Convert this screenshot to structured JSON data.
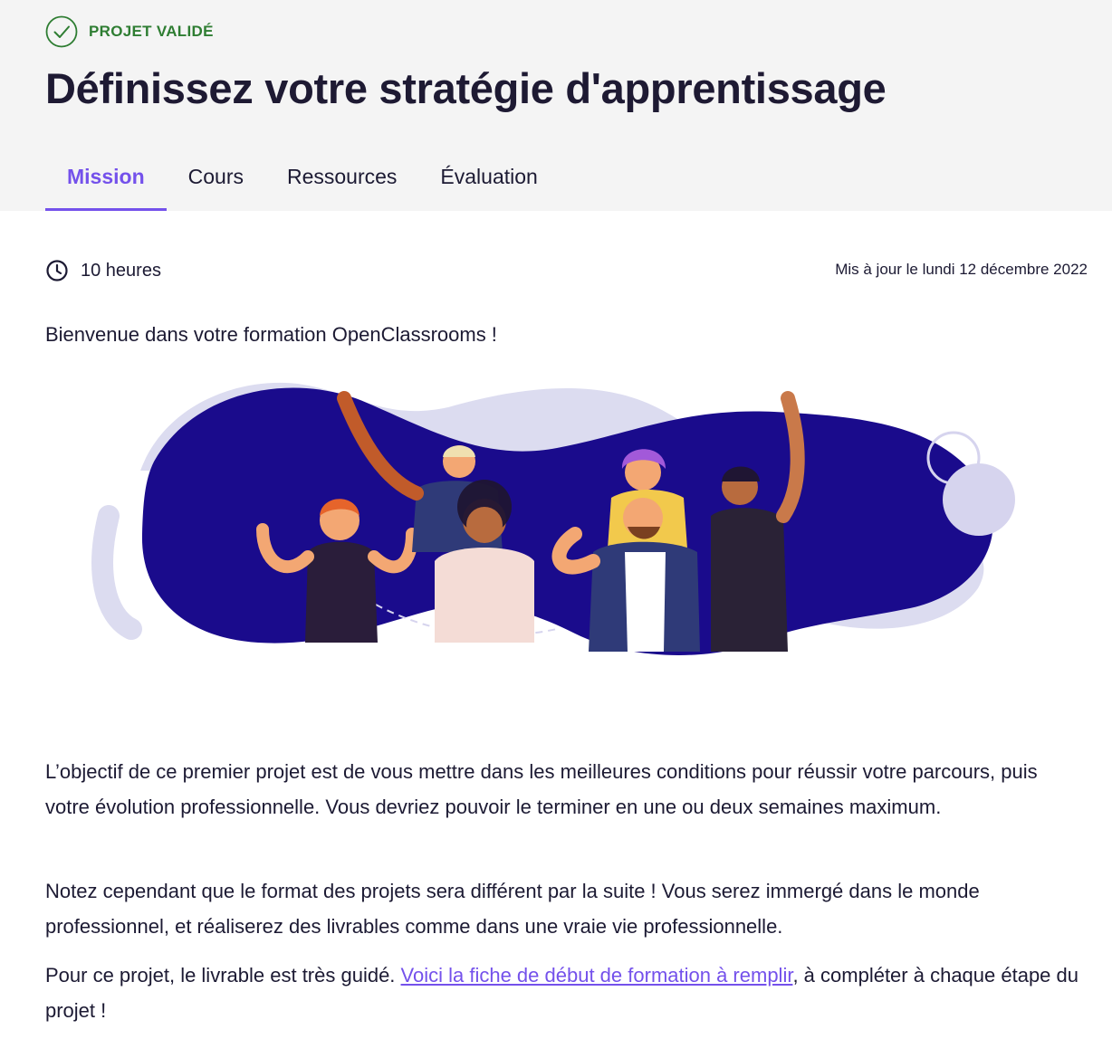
{
  "header": {
    "status_badge": "PROJET VALIDÉ",
    "title": "Définissez votre stratégie d'apprentissage"
  },
  "tabs": [
    {
      "label": "Mission",
      "active": true
    },
    {
      "label": "Cours",
      "active": false
    },
    {
      "label": "Ressources",
      "active": false
    },
    {
      "label": "Évaluation",
      "active": false
    }
  ],
  "meta": {
    "duration": "10 heures",
    "updated": "Mis à jour le lundi 12 décembre 2022"
  },
  "content": {
    "welcome": "Bienvenue dans votre formation OpenClassrooms !",
    "paragraph1": "L’objectif de ce premier projet est de vous mettre dans les meilleures conditions pour réussir votre parcours, puis votre évolution professionnelle. Vous devriez pouvoir le terminer en une ou deux semaines maximum.",
    "paragraph2": "Notez cependant que le format des projets sera différent par la suite ! Vous serez immergé dans le monde professionnel, et réaliserez des livrables comme dans une vraie vie professionnelle.",
    "paragraph3_before": "Pour ce projet, le livrable est très guidé. ",
    "paragraph3_link": "Voici la fiche de début de formation à remplir",
    "paragraph3_after": ", à compléter à chaque étape du projet !"
  },
  "colors": {
    "accent": "#7451eb",
    "success": "#2e7d32",
    "header_bg": "#f4f4f4",
    "illustration_blob": "#1a0b8c"
  },
  "icons": {
    "status": "check-circle-icon",
    "duration": "clock-icon"
  }
}
